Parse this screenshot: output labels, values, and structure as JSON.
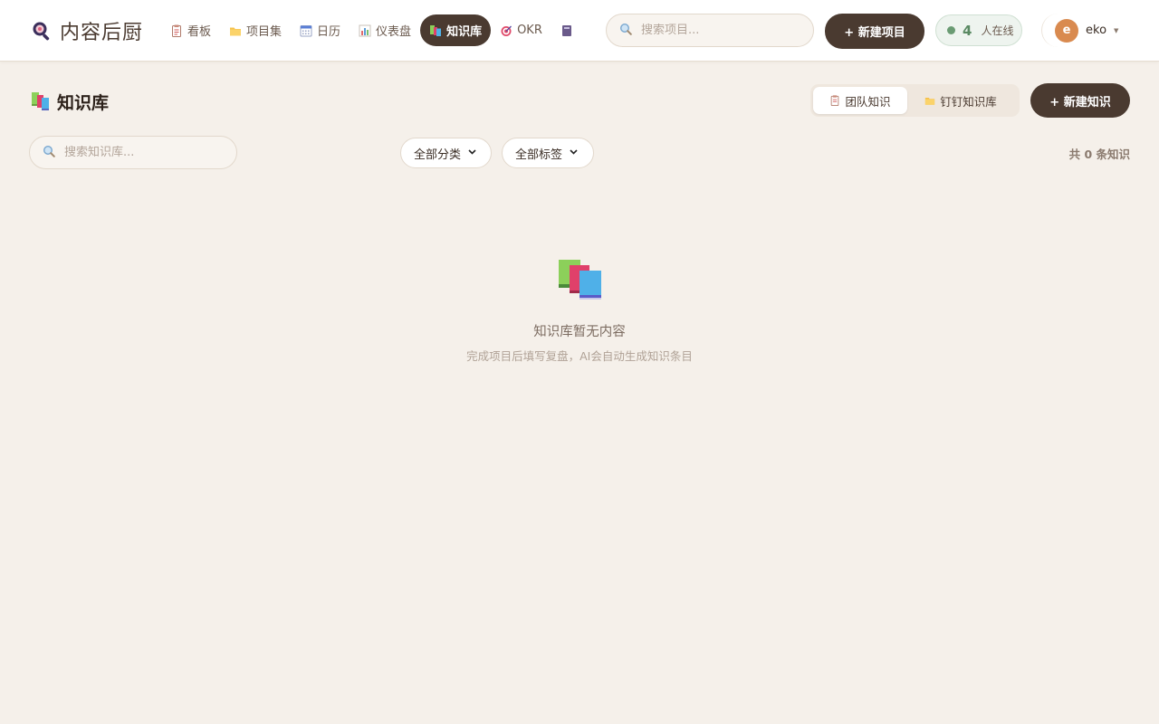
{
  "app": {
    "name": "内容后厨"
  },
  "nav": [
    {
      "label": "看板",
      "icon": "clipboard-icon"
    },
    {
      "label": "项目集",
      "icon": "folder-icon"
    },
    {
      "label": "日历",
      "icon": "calendar-icon"
    },
    {
      "label": "仪表盘",
      "icon": "bar-chart-icon"
    },
    {
      "label": "知识库",
      "icon": "books-icon",
      "active": true
    },
    {
      "label": "OKR",
      "icon": "target-icon"
    }
  ],
  "top_search": {
    "placeholder": "搜索项目..."
  },
  "new_project_label": "+ 新建项目",
  "online": {
    "count": "4",
    "label": "人在线"
  },
  "user": {
    "initial": "e",
    "name": "eko"
  },
  "page": {
    "title": "知识库"
  },
  "segments": {
    "team": "团队知识",
    "dingtalk": "钉钉知识库"
  },
  "new_knowledge_label": "+ 新建知识",
  "kb_search": {
    "placeholder": "搜索知识库..."
  },
  "filters": {
    "category": "全部分类",
    "tag": "全部标签"
  },
  "count_text": "共 0 条知识",
  "empty": {
    "title": "知识库暂无内容",
    "subtitle": "完成项目后填写复盘，AI会自动生成知识条目"
  },
  "colors": {
    "accent": "#4a3a30",
    "background": "#f5f0ea",
    "online": "#6a9b73",
    "avatar": "#d98a4f"
  }
}
